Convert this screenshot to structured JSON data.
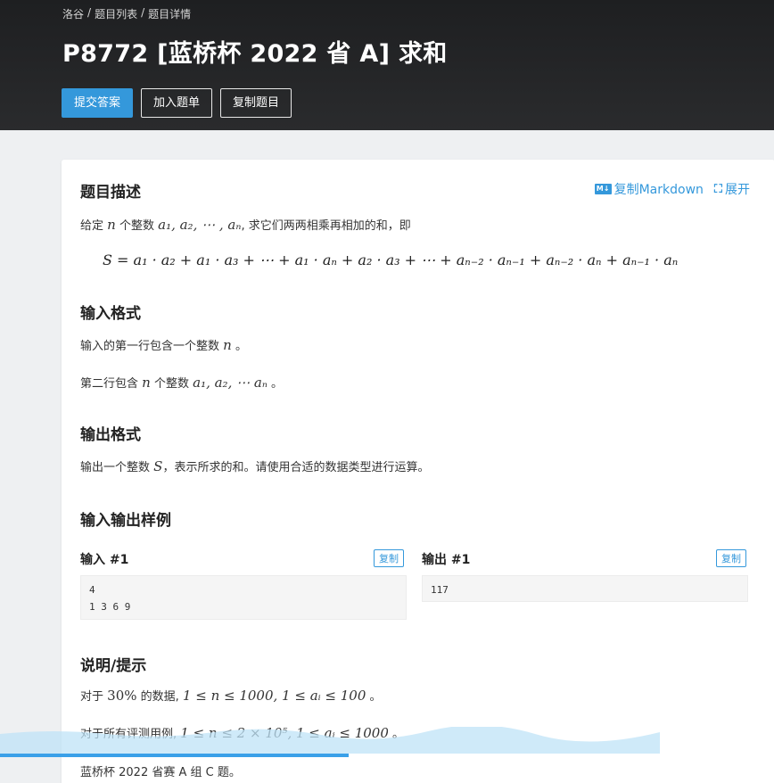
{
  "breadcrumb": [
    "洛谷",
    "题目列表",
    "题目详情"
  ],
  "breadcrumb_separator": "/",
  "title": "P8772 [蓝桥杯 2022 省 A] 求和",
  "buttons": {
    "submit": "提交答案",
    "add_to_list": "加入题单",
    "copy_problem": "复制题目"
  },
  "toolbar": {
    "copy_markdown": "复制Markdown",
    "md_icon": "M↓",
    "expand": "展开"
  },
  "description": {
    "heading": "题目描述",
    "line_prefix": "给定",
    "line_n": "n",
    "line_mid": "个整数",
    "line_seq": "a₁, a₂, ⋯ , aₙ",
    "line_suffix": ", 求它们两两相乘再相加的和，即",
    "formula": "S = a₁ · a₂ + a₁ · a₃ + ⋯ + a₁ · aₙ + a₂ · a₃ + ⋯ + aₙ₋₂ · aₙ₋₁ + aₙ₋₂ · aₙ + aₙ₋₁ · aₙ"
  },
  "input_format": {
    "heading": "输入格式",
    "line1_text": "输入的第一行包含一个整数",
    "line1_math": "n",
    "line1_end": "。",
    "line2_text_a": "第二行包含",
    "line2_math_n": "n",
    "line2_text_b": "个整数",
    "line2_math_seq": "a₁, a₂, ⋯ aₙ",
    "line2_end": "。"
  },
  "output_format": {
    "heading": "输出格式",
    "text_a": "输出一个整数",
    "math": "S",
    "text_b": "，表示所求的和。请使用合适的数据类型进行运算。"
  },
  "samples": {
    "heading": "输入输出样例",
    "input_label": "输入 #1",
    "output_label": "输出 #1",
    "copy": "复制",
    "input_value": "4\n1 3 6 9",
    "output_value": "117"
  },
  "hint": {
    "heading": "说明/提示",
    "line1_a": "对于",
    "line1_pct": "30%",
    "line1_b": "的数据,",
    "line1_math": "1 ≤ n ≤ 1000, 1 ≤ aᵢ ≤ 100",
    "line1_end": "。",
    "line2_a": "对于所有评测用例,",
    "line2_math": "1 ≤ n ≤ 2 × 10⁵, 1 ≤ aᵢ ≤ 1000",
    "line2_end": "。",
    "line3": "蓝桥杯 2022 省赛 A 组 C 题。"
  },
  "video_progress": 0.45,
  "colors": {
    "accent": "#3498db",
    "header_bg": "#1e1f21"
  }
}
